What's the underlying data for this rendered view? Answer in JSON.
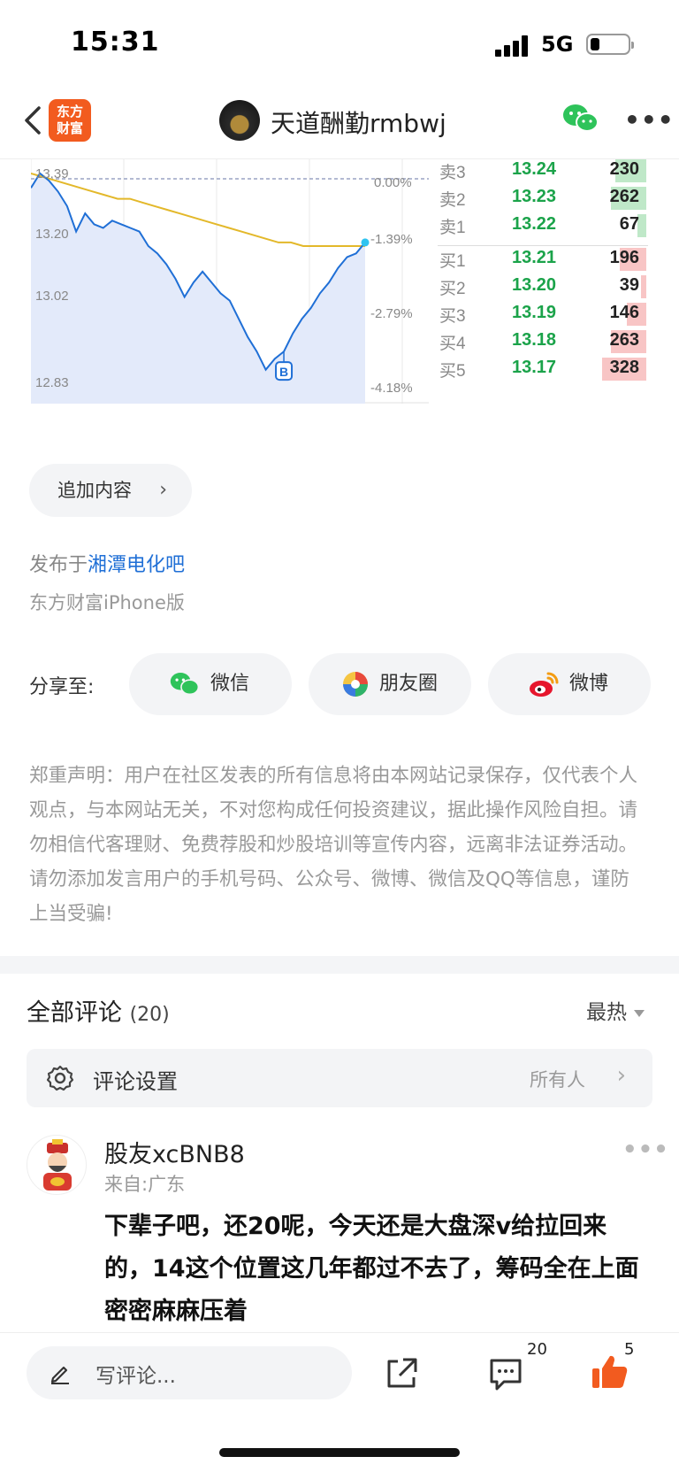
{
  "status": {
    "time": "15:31",
    "network": "5G"
  },
  "nav": {
    "logo_text_1": "东方",
    "logo_text_2": "财富",
    "title": "天道酬勤rmbwj"
  },
  "chart": {
    "y_left_labels": [
      "13.39",
      "13.20",
      "13.02",
      "12.83"
    ],
    "y_right_labels": [
      "0.00%",
      "-1.39%",
      "-2.79%",
      "-4.18%"
    ],
    "marker": "B"
  },
  "chart_data": {
    "type": "line",
    "ylim": [
      12.83,
      13.39
    ],
    "series": [
      {
        "values": [
          13.36,
          13.4,
          13.38,
          13.35,
          13.31,
          13.24,
          13.29,
          13.26,
          13.25,
          13.27,
          13.26,
          13.25,
          13.24,
          13.2,
          13.18,
          13.15,
          13.11,
          13.06,
          13.1,
          13.13,
          13.1,
          13.07,
          13.05,
          13.0,
          12.95,
          12.91,
          12.86,
          12.89,
          12.91,
          12.96,
          13.0,
          13.03,
          13.07,
          13.1,
          13.14,
          13.17,
          13.18,
          13.21
        ]
      },
      {
        "values": [
          13.4,
          13.39,
          13.38,
          13.37,
          13.36,
          13.35,
          13.34,
          13.33,
          13.33,
          13.32,
          13.31,
          13.3,
          13.29,
          13.28,
          13.27,
          13.26,
          13.25,
          13.24,
          13.23,
          13.22,
          13.21,
          13.21,
          13.2,
          13.2,
          13.2,
          13.2,
          13.2,
          13.2
        ]
      }
    ]
  },
  "order_book": [
    {
      "label": "卖3",
      "price": "13.24",
      "vol": "230",
      "side": "sell",
      "bar": 0.35
    },
    {
      "label": "卖2",
      "price": "13.23",
      "vol": "262",
      "side": "sell",
      "bar": 0.4
    },
    {
      "label": "卖1",
      "price": "13.22",
      "vol": "67",
      "side": "sell",
      "bar": 0.1
    },
    {
      "label": "买1",
      "price": "13.21",
      "vol": "196",
      "side": "buy",
      "bar": 0.3
    },
    {
      "label": "买2",
      "price": "13.20",
      "vol": "39",
      "side": "buy",
      "bar": 0.06
    },
    {
      "label": "买3",
      "price": "13.19",
      "vol": "146",
      "side": "buy",
      "bar": 0.22
    },
    {
      "label": "买4",
      "price": "13.18",
      "vol": "263",
      "side": "buy",
      "bar": 0.4
    },
    {
      "label": "买5",
      "price": "13.17",
      "vol": "328",
      "side": "buy",
      "bar": 0.5
    }
  ],
  "add_content": "追加内容",
  "posted": {
    "prefix": "发布于",
    "board": "湘潭电化吧"
  },
  "client": "东方财富iPhone版",
  "share": {
    "label": "分享至:",
    "wechat": "微信",
    "moments": "朋友圈",
    "weibo": "微博"
  },
  "disclaimer": "郑重声明：用户在社区发表的所有信息将由本网站记录保存，仅代表个人观点，与本网站无关，不对您构成任何投资建议，据此操作风险自担。请勿相信代客理财、免费荐股和炒股培训等宣传内容，远离非法证券活动。请勿添加发言用户的手机号码、公众号、微博、微信及QQ等信息，谨防上当受骗!",
  "comments": {
    "title": "全部评论",
    "count": "(20)",
    "sort": "最热",
    "settings_label": "评论设置",
    "settings_value": "所有人",
    "items": [
      {
        "user": "股友xcBNB8",
        "location": "来自:广东",
        "text": "下辈子吧，还20呢，今天还是大盘深v给拉回来的，14这个位置这几年都过不去了，筹码全在上面密密麻麻压着"
      }
    ]
  },
  "bottom": {
    "placeholder": "写评论...",
    "comment_count": "20",
    "like_count": "5"
  },
  "colors": {
    "accent": "#f25b1f",
    "link": "#1f6fd6",
    "buy_green": "#1ba34a",
    "price_line": "#1f6fd6",
    "avg_line": "#e3b82a"
  }
}
